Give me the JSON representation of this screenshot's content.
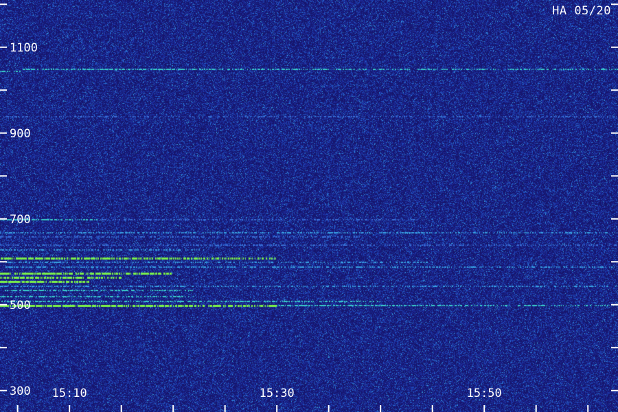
{
  "chart_data": {
    "type": "heatmap",
    "title": "",
    "station_label": "HA 05/20",
    "xlabel": "",
    "ylabel": "",
    "x_range": [
      "15:03",
      "15:53"
    ],
    "xlim_minutes": [
      3.3,
      62.9
    ],
    "ylim": [
      250,
      1210
    ],
    "y_ticks": [
      300,
      500,
      700,
      900,
      1100
    ],
    "x_tick_labels": [
      "15:10",
      "15:30",
      "15:50"
    ],
    "x_tick_values_minutes": [
      10,
      30,
      50
    ],
    "x_minor_tick_step_minutes": 5,
    "y_minor_tick_step": 100,
    "colors": {
      "background": "#16166e",
      "weak": "#3a7bd5",
      "medium": "#38b6e0",
      "strong": "#7af04a"
    },
    "traces": [
      {
        "freq": 1050,
        "start": 5.5,
        "end": 62.9,
        "intensity": 0.55
      },
      {
        "freq": 1045,
        "start": 3.3,
        "end": 5.3,
        "intensity": 0.7
      },
      {
        "freq": 940,
        "start": 3.3,
        "end": 62.9,
        "intensity": 0.2
      },
      {
        "freq": 700,
        "start": 3.3,
        "end": 13.0,
        "intensity": 0.75
      },
      {
        "freq": 700,
        "start": 13.0,
        "end": 45.0,
        "intensity": 0.3
      },
      {
        "freq": 670,
        "start": 3.3,
        "end": 62.9,
        "intensity": 0.45
      },
      {
        "freq": 660,
        "start": 3.3,
        "end": 38.0,
        "intensity": 0.3
      },
      {
        "freq": 640,
        "start": 3.3,
        "end": 62.9,
        "intensity": 0.3
      },
      {
        "freq": 630,
        "start": 3.3,
        "end": 23.0,
        "intensity": 0.35
      },
      {
        "freq": 610,
        "start": 3.3,
        "end": 30.0,
        "intensity": 0.85
      },
      {
        "freq": 600,
        "start": 3.3,
        "end": 45.0,
        "intensity": 0.35
      },
      {
        "freq": 590,
        "start": 3.3,
        "end": 62.9,
        "intensity": 0.4
      },
      {
        "freq": 575,
        "start": 3.3,
        "end": 20.0,
        "intensity": 0.9
      },
      {
        "freq": 565,
        "start": 3.3,
        "end": 15.0,
        "intensity": 0.8
      },
      {
        "freq": 555,
        "start": 3.3,
        "end": 12.0,
        "intensity": 0.9
      },
      {
        "freq": 545,
        "start": 3.3,
        "end": 62.9,
        "intensity": 0.35
      },
      {
        "freq": 535,
        "start": 3.3,
        "end": 22.0,
        "intensity": 0.6
      },
      {
        "freq": 520,
        "start": 3.3,
        "end": 22.0,
        "intensity": 0.55
      },
      {
        "freq": 510,
        "start": 3.3,
        "end": 40.0,
        "intensity": 0.55
      },
      {
        "freq": 500,
        "start": 3.3,
        "end": 30.0,
        "intensity": 1.0
      },
      {
        "freq": 500,
        "start": 30.0,
        "end": 62.9,
        "intensity": 0.55
      }
    ]
  }
}
